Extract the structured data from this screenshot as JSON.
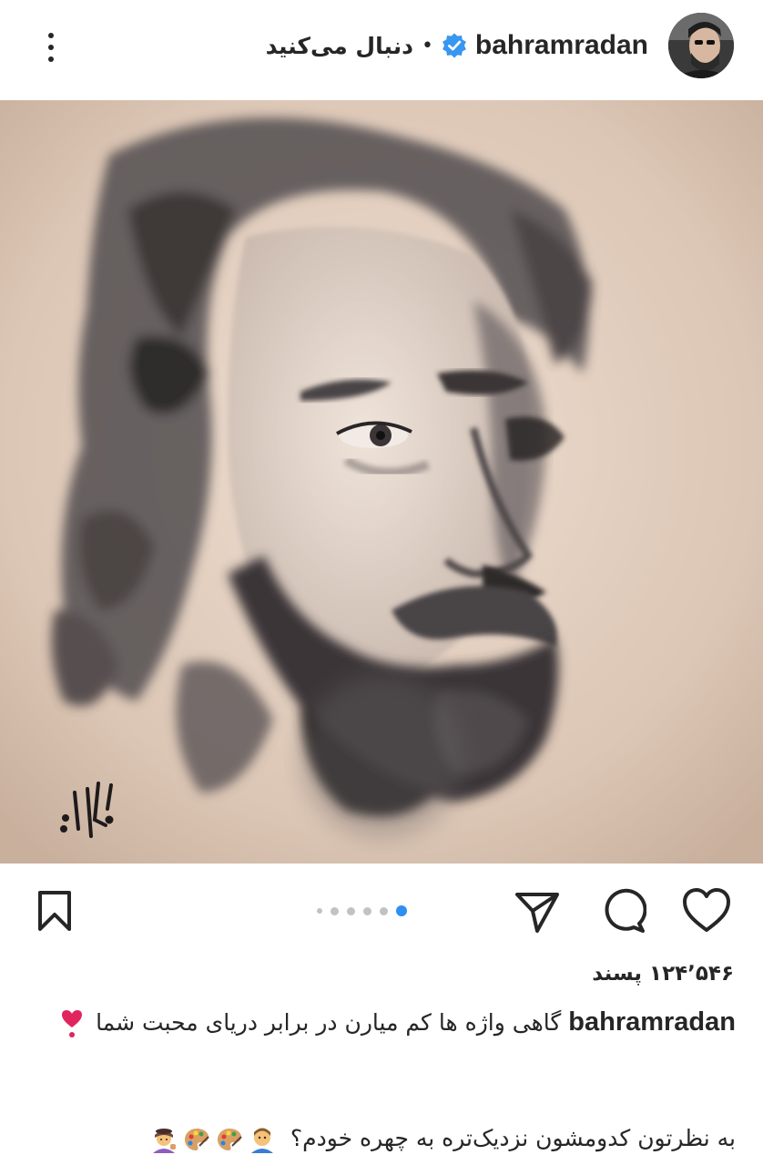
{
  "header": {
    "username": "bahramradan",
    "follow_label": "دنبال می‌کنید",
    "separator": "•",
    "verified_icon": "verified-badge-icon",
    "more_icon": "more-vertical-icon"
  },
  "post": {
    "image_description_icon": "portrait-painting",
    "signature_icon": "artist-signature"
  },
  "actions": {
    "like_icon": "heart-icon",
    "comment_icon": "comment-icon",
    "share_icon": "send-icon",
    "save_icon": "bookmark-icon",
    "carousel_count": 6,
    "carousel_active_index": 5
  },
  "stats": {
    "likes_text": "۱۲۴٬۵۴۶ پسند"
  },
  "caption": {
    "username": "bahramradan",
    "text": "گاهی واژه ها کم میارن در برابر دریای محبت شما",
    "trailing_icon": "red-heart-exclamation-icon",
    "question": "به نظرتون کدومشون نزدیک‌تره به چهره خودم؟",
    "emojis": [
      "man-emoji",
      "palette-emoji",
      "palette-emoji",
      "artist-emoji"
    ]
  },
  "colors": {
    "text": "#262626",
    "accent_blue": "#2f8ff0",
    "verified_blue": "#3897f0",
    "dot_gray": "#c2c2c2",
    "heart_red": "#e0245e",
    "paper": "#dbc5b4"
  }
}
